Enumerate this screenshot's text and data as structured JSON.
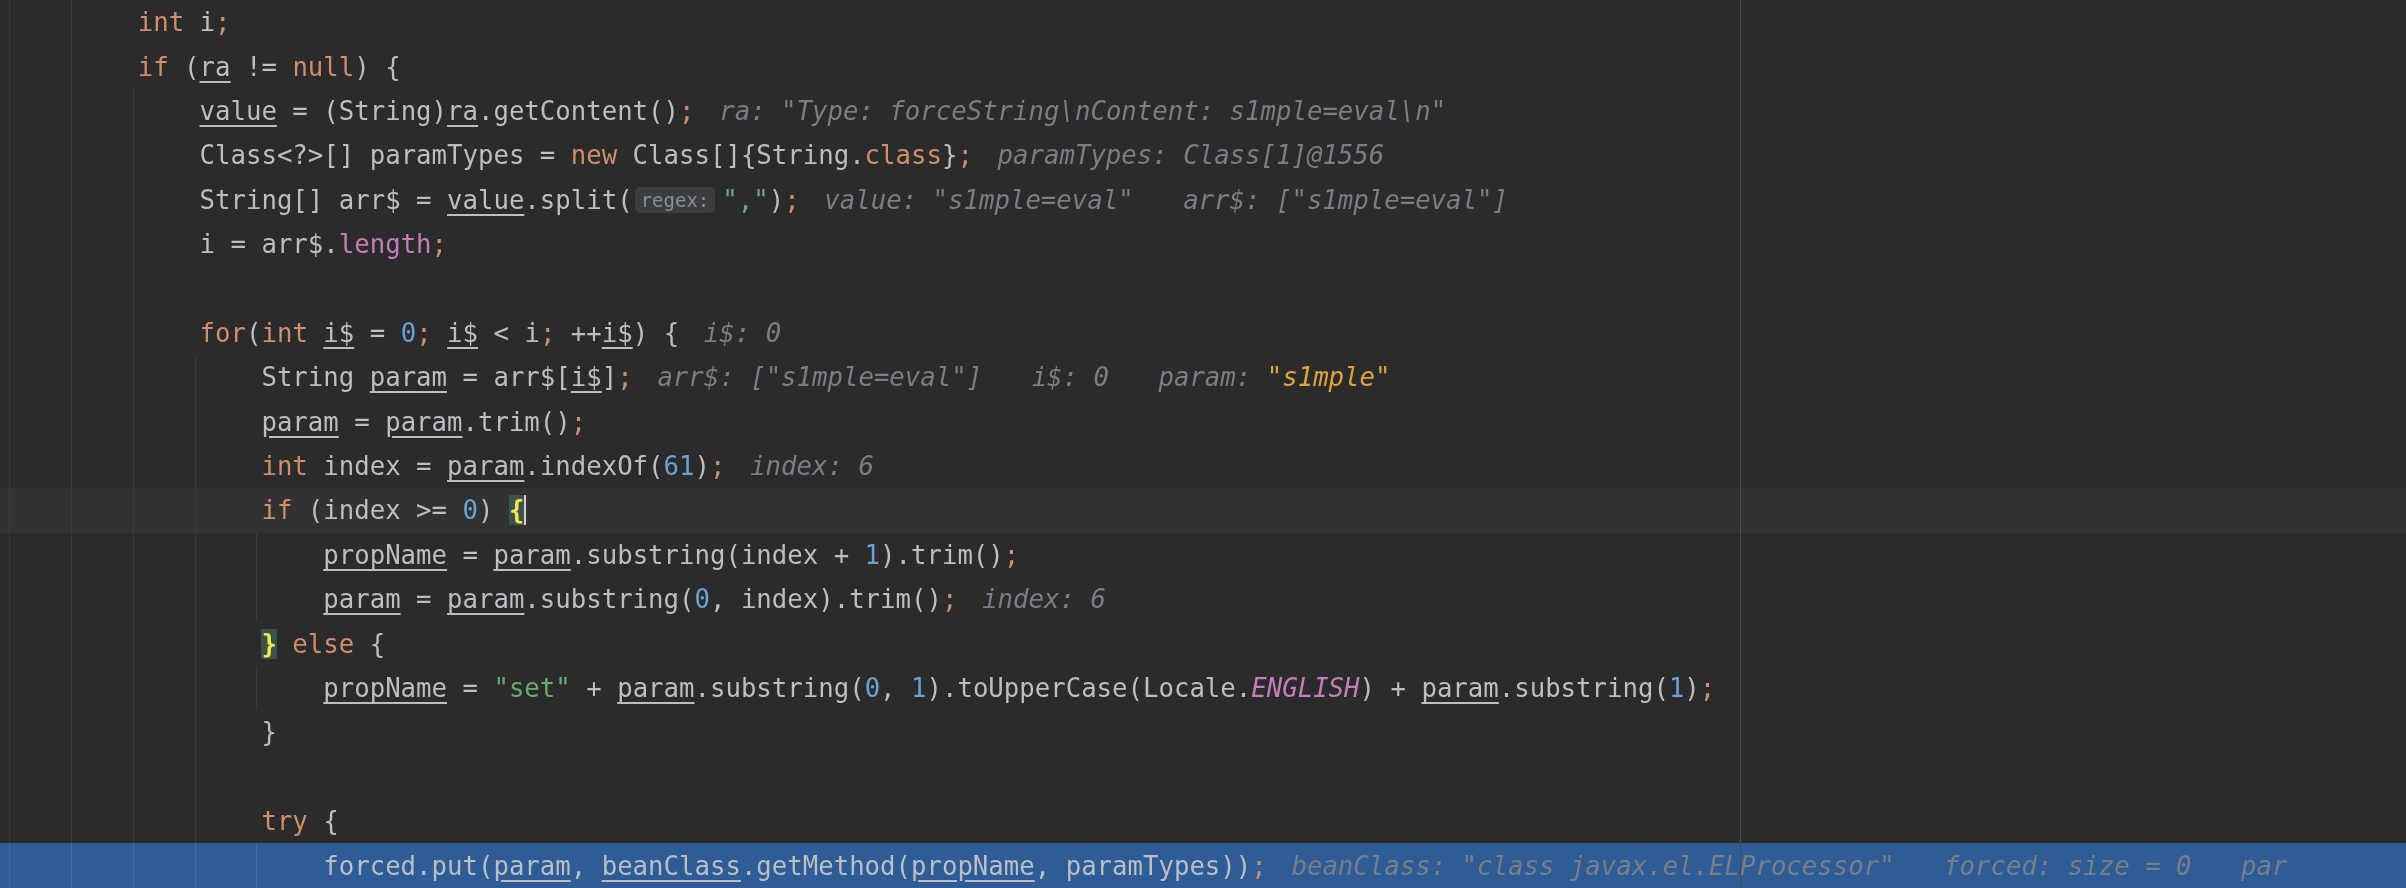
{
  "editor": {
    "lines": [
      {
        "kind": "code",
        "tokens": [
          {
            "kind": "kw",
            "text": "int"
          },
          {
            "kind": "plain",
            "text": " i"
          },
          {
            "kind": "kw",
            "text": ";"
          }
        ]
      },
      {
        "kind": "code",
        "tokens": [
          {
            "kind": "kw",
            "text": "if"
          },
          {
            "kind": "plain",
            "text": " ("
          },
          {
            "kind": "local",
            "text": "ra"
          },
          {
            "kind": "plain",
            "text": " != "
          },
          {
            "kind": "kw",
            "text": "null"
          },
          {
            "kind": "plain",
            "text": ") {"
          }
        ],
        "children": [
          {
            "kind": "code",
            "tokens": [
              {
                "kind": "local",
                "text": "value"
              },
              {
                "kind": "plain",
                "text": " = (String)"
              },
              {
                "kind": "local",
                "text": "ra"
              },
              {
                "kind": "plain",
                "text": ".getContent()"
              },
              {
                "kind": "kw",
                "text": ";"
              }
            ],
            "hints": [
              {
                "label": "ra:",
                "value": "\"Type: forceString\\nContent: s1mple=eval\\n\""
              }
            ]
          },
          {
            "kind": "code",
            "tokens": [
              {
                "kind": "plain",
                "text": "Class<?>[] paramTypes = "
              },
              {
                "kind": "kw",
                "text": "new"
              },
              {
                "kind": "plain",
                "text": " Class[]{String."
              },
              {
                "kind": "kw",
                "text": "class"
              },
              {
                "kind": "plain",
                "text": "}"
              },
              {
                "kind": "kw",
                "text": ";"
              }
            ],
            "hints": [
              {
                "label": "paramTypes:",
                "value": "Class[1]@1556"
              }
            ]
          },
          {
            "kind": "code",
            "tokens": [
              {
                "kind": "plain",
                "text": "String[] arr$ = "
              },
              {
                "kind": "local",
                "text": "value"
              },
              {
                "kind": "plain",
                "text": ".split("
              },
              {
                "kind": "inlay",
                "text": "regex:"
              },
              {
                "kind": "str",
                "text": "\",\""
              },
              {
                "kind": "plain",
                "text": ")"
              },
              {
                "kind": "kw",
                "text": ";"
              }
            ],
            "hints": [
              {
                "label": "value:",
                "value": "\"s1mple=eval\""
              },
              {
                "label": "arr$:",
                "value": "[\"s1mple=eval\"]"
              }
            ]
          },
          {
            "kind": "code",
            "tokens": [
              {
                "kind": "plain",
                "text": "i = arr$."
              },
              {
                "kind": "field",
                "text": "length"
              },
              {
                "kind": "kw",
                "text": ";"
              }
            ]
          },
          {
            "kind": "blank"
          },
          {
            "kind": "code",
            "tokens": [
              {
                "kind": "kw",
                "text": "for"
              },
              {
                "kind": "plain",
                "text": "("
              },
              {
                "kind": "kw",
                "text": "int "
              },
              {
                "kind": "local",
                "text": "i$"
              },
              {
                "kind": "plain",
                "text": " = "
              },
              {
                "kind": "num",
                "text": "0"
              },
              {
                "kind": "kw",
                "text": "; "
              },
              {
                "kind": "local",
                "text": "i$"
              },
              {
                "kind": "plain",
                "text": " < i"
              },
              {
                "kind": "kw",
                "text": ";"
              },
              {
                "kind": "plain",
                "text": " ++"
              },
              {
                "kind": "local",
                "text": "i$"
              },
              {
                "kind": "plain",
                "text": ") {"
              }
            ],
            "hints": [
              {
                "label": "i$:",
                "value": "0"
              }
            ],
            "children": [
              {
                "kind": "code",
                "tokens": [
                  {
                    "kind": "plain",
                    "text": "String "
                  },
                  {
                    "kind": "local",
                    "text": "param"
                  },
                  {
                    "kind": "plain",
                    "text": " = arr$["
                  },
                  {
                    "kind": "local",
                    "text": "i$"
                  },
                  {
                    "kind": "plain",
                    "text": "]"
                  },
                  {
                    "kind": "kw",
                    "text": ";"
                  }
                ],
                "hints": [
                  {
                    "label": "arr$:",
                    "value": "[\"s1mple=eval\"]"
                  },
                  {
                    "label": "i$:",
                    "value": "0"
                  },
                  {
                    "label": "param:",
                    "value": "\"s1mple\"",
                    "changed": true
                  }
                ]
              },
              {
                "kind": "code",
                "tokens": [
                  {
                    "kind": "local",
                    "text": "param"
                  },
                  {
                    "kind": "plain",
                    "text": " = "
                  },
                  {
                    "kind": "local",
                    "text": "param"
                  },
                  {
                    "kind": "plain",
                    "text": ".trim()"
                  },
                  {
                    "kind": "kw",
                    "text": ";"
                  }
                ]
              },
              {
                "kind": "code",
                "tokens": [
                  {
                    "kind": "kw",
                    "text": "int"
                  },
                  {
                    "kind": "plain",
                    "text": " index = "
                  },
                  {
                    "kind": "local",
                    "text": "param"
                  },
                  {
                    "kind": "plain",
                    "text": ".indexOf("
                  },
                  {
                    "kind": "num",
                    "text": "61"
                  },
                  {
                    "kind": "plain",
                    "text": ")"
                  },
                  {
                    "kind": "kw",
                    "text": ";"
                  }
                ],
                "hints": [
                  {
                    "label": "index:",
                    "value": "6"
                  }
                ]
              },
              {
                "kind": "code",
                "caret": true,
                "tokens": [
                  {
                    "kind": "kw",
                    "text": "if"
                  },
                  {
                    "kind": "plain",
                    "text": " (index >= "
                  },
                  {
                    "kind": "num",
                    "text": "0"
                  },
                  {
                    "kind": "plain",
                    "text": ") "
                  },
                  {
                    "kind": "brace",
                    "text": "{"
                  }
                ],
                "children": [
                  {
                    "kind": "code",
                    "tokens": [
                      {
                        "kind": "local",
                        "text": "propName"
                      },
                      {
                        "kind": "plain",
                        "text": " = "
                      },
                      {
                        "kind": "local",
                        "text": "param"
                      },
                      {
                        "kind": "plain",
                        "text": ".substring(index + "
                      },
                      {
                        "kind": "num",
                        "text": "1"
                      },
                      {
                        "kind": "plain",
                        "text": ").trim()"
                      },
                      {
                        "kind": "kw",
                        "text": ";"
                      }
                    ]
                  },
                  {
                    "kind": "code",
                    "tokens": [
                      {
                        "kind": "local",
                        "text": "param"
                      },
                      {
                        "kind": "plain",
                        "text": " = "
                      },
                      {
                        "kind": "local",
                        "text": "param"
                      },
                      {
                        "kind": "plain",
                        "text": ".substring("
                      },
                      {
                        "kind": "num",
                        "text": "0"
                      },
                      {
                        "kind": "plain",
                        "text": ", index).trim()"
                      },
                      {
                        "kind": "kw",
                        "text": ";"
                      }
                    ],
                    "hints": [
                      {
                        "label": "index:",
                        "value": "6"
                      }
                    ]
                  }
                ]
              },
              {
                "kind": "code",
                "tokens": [
                  {
                    "kind": "brace",
                    "text": "}"
                  },
                  {
                    "kind": "kw",
                    "text": " else"
                  },
                  {
                    "kind": "plain",
                    "text": " {"
                  }
                ],
                "children": [
                  {
                    "kind": "code",
                    "tokens": [
                      {
                        "kind": "local",
                        "text": "propName"
                      },
                      {
                        "kind": "plain",
                        "text": " = "
                      },
                      {
                        "kind": "str",
                        "text": "\"set\""
                      },
                      {
                        "kind": "plain",
                        "text": " + "
                      },
                      {
                        "kind": "local",
                        "text": "param"
                      },
                      {
                        "kind": "plain",
                        "text": ".substring("
                      },
                      {
                        "kind": "num",
                        "text": "0"
                      },
                      {
                        "kind": "plain",
                        "text": ", "
                      },
                      {
                        "kind": "num",
                        "text": "1"
                      },
                      {
                        "kind": "plain",
                        "text": ").toUpperCase(Locale."
                      },
                      {
                        "kind": "static",
                        "text": "ENGLISH"
                      },
                      {
                        "kind": "plain",
                        "text": ") + "
                      },
                      {
                        "kind": "local",
                        "text": "param"
                      },
                      {
                        "kind": "plain",
                        "text": ".substring("
                      },
                      {
                        "kind": "num",
                        "text": "1"
                      },
                      {
                        "kind": "plain",
                        "text": ")"
                      },
                      {
                        "kind": "kw",
                        "text": ";"
                      }
                    ]
                  }
                ]
              },
              {
                "kind": "code",
                "tokens": [
                  {
                    "kind": "plain",
                    "text": "}"
                  }
                ]
              },
              {
                "kind": "blank"
              },
              {
                "kind": "code",
                "tokens": [
                  {
                    "kind": "kw",
                    "text": "try"
                  },
                  {
                    "kind": "plain",
                    "text": " {"
                  }
                ],
                "children": [
                  {
                    "kind": "code",
                    "execution": true,
                    "tokens": [
                      {
                        "kind": "plain",
                        "text": "forced.put("
                      },
                      {
                        "kind": "local",
                        "text": "param"
                      },
                      {
                        "kind": "plain",
                        "text": ", "
                      },
                      {
                        "kind": "local",
                        "text": "beanClass"
                      },
                      {
                        "kind": "plain",
                        "text": ".getMethod("
                      },
                      {
                        "kind": "local",
                        "text": "propName"
                      },
                      {
                        "kind": "plain",
                        "text": ", paramTypes))"
                      },
                      {
                        "kind": "kw",
                        "text": ";"
                      }
                    ],
                    "hints": [
                      {
                        "label": "beanClass:",
                        "value": "\"class javax.el.ELProcessor\""
                      },
                      {
                        "label": "forced:",
                        "value": "size = 0"
                      },
                      {
                        "label": "par"
                      }
                    ]
                  }
                ]
              }
            ]
          }
        ]
      }
    ]
  }
}
